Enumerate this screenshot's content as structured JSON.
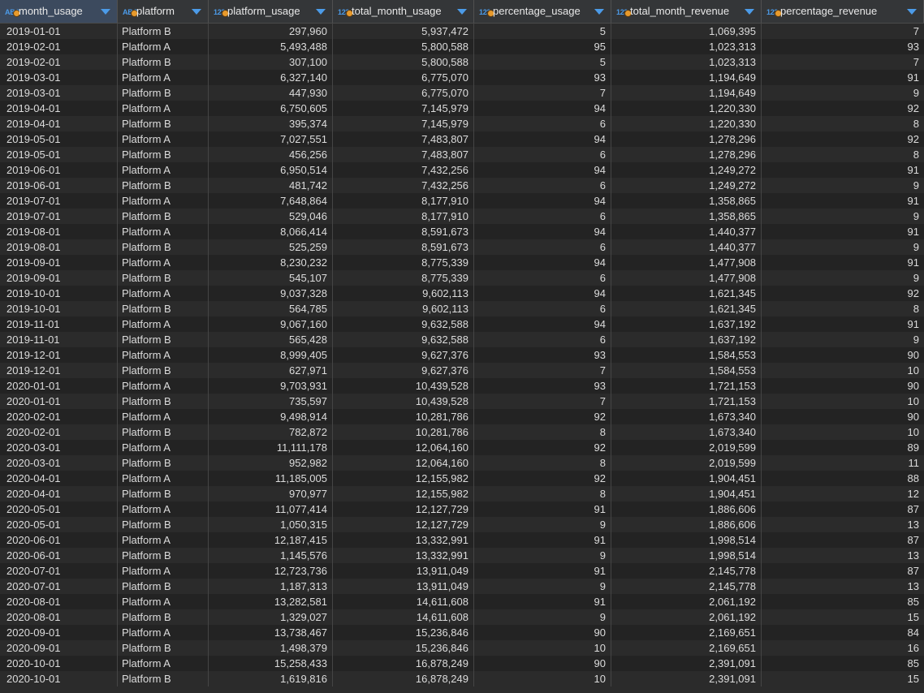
{
  "columns": [
    {
      "name": "month_usage",
      "type": "ABC"
    },
    {
      "name": "platform",
      "type": "ABC"
    },
    {
      "name": "platform_usage",
      "type": "123"
    },
    {
      "name": "total_month_usage",
      "type": "123"
    },
    {
      "name": "percentage_usage",
      "type": "123"
    },
    {
      "name": "total_month_revenue",
      "type": "123"
    },
    {
      "name": "percentage_revenue",
      "type": "123"
    }
  ],
  "rows": [
    [
      "2019-01-01",
      "Platform B",
      "297,960",
      "5,937,472",
      "5",
      "1,069,395",
      "7"
    ],
    [
      "2019-02-01",
      "Platform A",
      "5,493,488",
      "5,800,588",
      "95",
      "1,023,313",
      "93"
    ],
    [
      "2019-02-01",
      "Platform B",
      "307,100",
      "5,800,588",
      "5",
      "1,023,313",
      "7"
    ],
    [
      "2019-03-01",
      "Platform A",
      "6,327,140",
      "6,775,070",
      "93",
      "1,194,649",
      "91"
    ],
    [
      "2019-03-01",
      "Platform B",
      "447,930",
      "6,775,070",
      "7",
      "1,194,649",
      "9"
    ],
    [
      "2019-04-01",
      "Platform A",
      "6,750,605",
      "7,145,979",
      "94",
      "1,220,330",
      "92"
    ],
    [
      "2019-04-01",
      "Platform B",
      "395,374",
      "7,145,979",
      "6",
      "1,220,330",
      "8"
    ],
    [
      "2019-05-01",
      "Platform A",
      "7,027,551",
      "7,483,807",
      "94",
      "1,278,296",
      "92"
    ],
    [
      "2019-05-01",
      "Platform B",
      "456,256",
      "7,483,807",
      "6",
      "1,278,296",
      "8"
    ],
    [
      "2019-06-01",
      "Platform A",
      "6,950,514",
      "7,432,256",
      "94",
      "1,249,272",
      "91"
    ],
    [
      "2019-06-01",
      "Platform B",
      "481,742",
      "7,432,256",
      "6",
      "1,249,272",
      "9"
    ],
    [
      "2019-07-01",
      "Platform A",
      "7,648,864",
      "8,177,910",
      "94",
      "1,358,865",
      "91"
    ],
    [
      "2019-07-01",
      "Platform B",
      "529,046",
      "8,177,910",
      "6",
      "1,358,865",
      "9"
    ],
    [
      "2019-08-01",
      "Platform A",
      "8,066,414",
      "8,591,673",
      "94",
      "1,440,377",
      "91"
    ],
    [
      "2019-08-01",
      "Platform B",
      "525,259",
      "8,591,673",
      "6",
      "1,440,377",
      "9"
    ],
    [
      "2019-09-01",
      "Platform A",
      "8,230,232",
      "8,775,339",
      "94",
      "1,477,908",
      "91"
    ],
    [
      "2019-09-01",
      "Platform B",
      "545,107",
      "8,775,339",
      "6",
      "1,477,908",
      "9"
    ],
    [
      "2019-10-01",
      "Platform A",
      "9,037,328",
      "9,602,113",
      "94",
      "1,621,345",
      "92"
    ],
    [
      "2019-10-01",
      "Platform B",
      "564,785",
      "9,602,113",
      "6",
      "1,621,345",
      "8"
    ],
    [
      "2019-11-01",
      "Platform A",
      "9,067,160",
      "9,632,588",
      "94",
      "1,637,192",
      "91"
    ],
    [
      "2019-11-01",
      "Platform B",
      "565,428",
      "9,632,588",
      "6",
      "1,637,192",
      "9"
    ],
    [
      "2019-12-01",
      "Platform A",
      "8,999,405",
      "9,627,376",
      "93",
      "1,584,553",
      "90"
    ],
    [
      "2019-12-01",
      "Platform B",
      "627,971",
      "9,627,376",
      "7",
      "1,584,553",
      "10"
    ],
    [
      "2020-01-01",
      "Platform A",
      "9,703,931",
      "10,439,528",
      "93",
      "1,721,153",
      "90"
    ],
    [
      "2020-01-01",
      "Platform B",
      "735,597",
      "10,439,528",
      "7",
      "1,721,153",
      "10"
    ],
    [
      "2020-02-01",
      "Platform A",
      "9,498,914",
      "10,281,786",
      "92",
      "1,673,340",
      "90"
    ],
    [
      "2020-02-01",
      "Platform B",
      "782,872",
      "10,281,786",
      "8",
      "1,673,340",
      "10"
    ],
    [
      "2020-03-01",
      "Platform A",
      "11,111,178",
      "12,064,160",
      "92",
      "2,019,599",
      "89"
    ],
    [
      "2020-03-01",
      "Platform B",
      "952,982",
      "12,064,160",
      "8",
      "2,019,599",
      "11"
    ],
    [
      "2020-04-01",
      "Platform A",
      "11,185,005",
      "12,155,982",
      "92",
      "1,904,451",
      "88"
    ],
    [
      "2020-04-01",
      "Platform B",
      "970,977",
      "12,155,982",
      "8",
      "1,904,451",
      "12"
    ],
    [
      "2020-05-01",
      "Platform A",
      "11,077,414",
      "12,127,729",
      "91",
      "1,886,606",
      "87"
    ],
    [
      "2020-05-01",
      "Platform B",
      "1,050,315",
      "12,127,729",
      "9",
      "1,886,606",
      "13"
    ],
    [
      "2020-06-01",
      "Platform A",
      "12,187,415",
      "13,332,991",
      "91",
      "1,998,514",
      "87"
    ],
    [
      "2020-06-01",
      "Platform B",
      "1,145,576",
      "13,332,991",
      "9",
      "1,998,514",
      "13"
    ],
    [
      "2020-07-01",
      "Platform A",
      "12,723,736",
      "13,911,049",
      "91",
      "2,145,778",
      "87"
    ],
    [
      "2020-07-01",
      "Platform B",
      "1,187,313",
      "13,911,049",
      "9",
      "2,145,778",
      "13"
    ],
    [
      "2020-08-01",
      "Platform A",
      "13,282,581",
      "14,611,608",
      "91",
      "2,061,192",
      "85"
    ],
    [
      "2020-08-01",
      "Platform B",
      "1,329,027",
      "14,611,608",
      "9",
      "2,061,192",
      "15"
    ],
    [
      "2020-09-01",
      "Platform A",
      "13,738,467",
      "15,236,846",
      "90",
      "2,169,651",
      "84"
    ],
    [
      "2020-09-01",
      "Platform B",
      "1,498,379",
      "15,236,846",
      "10",
      "2,169,651",
      "16"
    ],
    [
      "2020-10-01",
      "Platform A",
      "15,258,433",
      "16,878,249",
      "90",
      "2,391,091",
      "85"
    ],
    [
      "2020-10-01",
      "Platform B",
      "1,619,816",
      "16,878,249",
      "10",
      "2,391,091",
      "15"
    ]
  ],
  "colors": {
    "accent": "#4c9be8",
    "key_dot": "#e89a2c",
    "background": "#2b2b2b",
    "row_alt": "#232323"
  }
}
